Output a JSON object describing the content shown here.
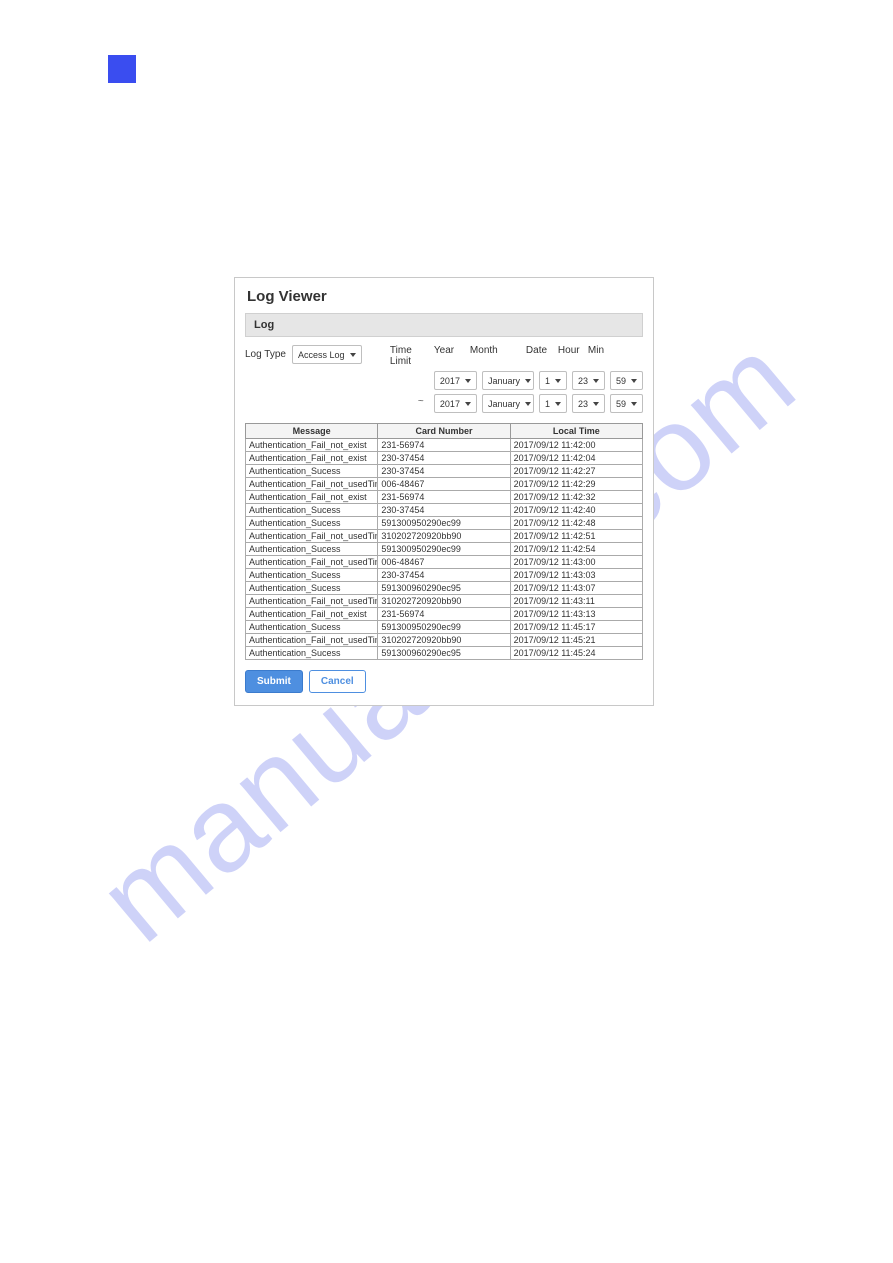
{
  "panel": {
    "title": "Log Viewer",
    "section_label": "Log",
    "log_type_label": "Log Type",
    "log_type_value": "Access Log",
    "time_limit_label": "Time Limit",
    "time_headers": {
      "year": "Year",
      "month": "Month",
      "date": "Date",
      "hour": "Hour",
      "min": "Min"
    },
    "from": {
      "year": "2017",
      "month": "January",
      "date": "1",
      "hour": "23",
      "min": "59"
    },
    "to": {
      "year": "2017",
      "month": "January",
      "date": "1",
      "hour": "23",
      "min": "59"
    },
    "columns": {
      "message": "Message",
      "card": "Card Number",
      "time": "Local Time"
    },
    "rows": [
      {
        "message": "Authentication_Fail_not_exist",
        "card": "231-56974",
        "time": "2017/09/12 11:42:00"
      },
      {
        "message": "Authentication_Fail_not_exist",
        "card": "230-37454",
        "time": "2017/09/12 11:42:04"
      },
      {
        "message": "Authentication_Sucess",
        "card": "230-37454",
        "time": "2017/09/12 11:42:27"
      },
      {
        "message": "Authentication_Fail_not_usedTime",
        "card": "006-48467",
        "time": "2017/09/12 11:42:29"
      },
      {
        "message": "Authentication_Fail_not_exist",
        "card": "231-56974",
        "time": "2017/09/12 11:42:32"
      },
      {
        "message": "Authentication_Sucess",
        "card": "230-37454",
        "time": "2017/09/12 11:42:40"
      },
      {
        "message": "Authentication_Sucess",
        "card": "591300950290ec99",
        "time": "2017/09/12 11:42:48"
      },
      {
        "message": "Authentication_Fail_not_usedTime",
        "card": "310202720920bb90",
        "time": "2017/09/12 11:42:51"
      },
      {
        "message": "Authentication_Sucess",
        "card": "591300950290ec99",
        "time": "2017/09/12 11:42:54"
      },
      {
        "message": "Authentication_Fail_not_usedTime",
        "card": "006-48467",
        "time": "2017/09/12 11:43:00"
      },
      {
        "message": "Authentication_Sucess",
        "card": "230-37454",
        "time": "2017/09/12 11:43:03"
      },
      {
        "message": "Authentication_Sucess",
        "card": "591300960290ec95",
        "time": "2017/09/12 11:43:07"
      },
      {
        "message": "Authentication_Fail_not_usedTime",
        "card": "310202720920bb90",
        "time": "2017/09/12 11:43:11"
      },
      {
        "message": "Authentication_Fail_not_exist",
        "card": "231-56974",
        "time": "2017/09/12 11:43:13"
      },
      {
        "message": "Authentication_Sucess",
        "card": "591300950290ec99",
        "time": "2017/09/12 11:45:17"
      },
      {
        "message": "Authentication_Fail_not_usedTime",
        "card": "310202720920bb90",
        "time": "2017/09/12 11:45:21"
      },
      {
        "message": "Authentication_Sucess",
        "card": "591300960290ec95",
        "time": "2017/09/12 11:45:24"
      }
    ],
    "submit_label": "Submit",
    "cancel_label": "Cancel"
  },
  "watermark": "manualslib.com"
}
